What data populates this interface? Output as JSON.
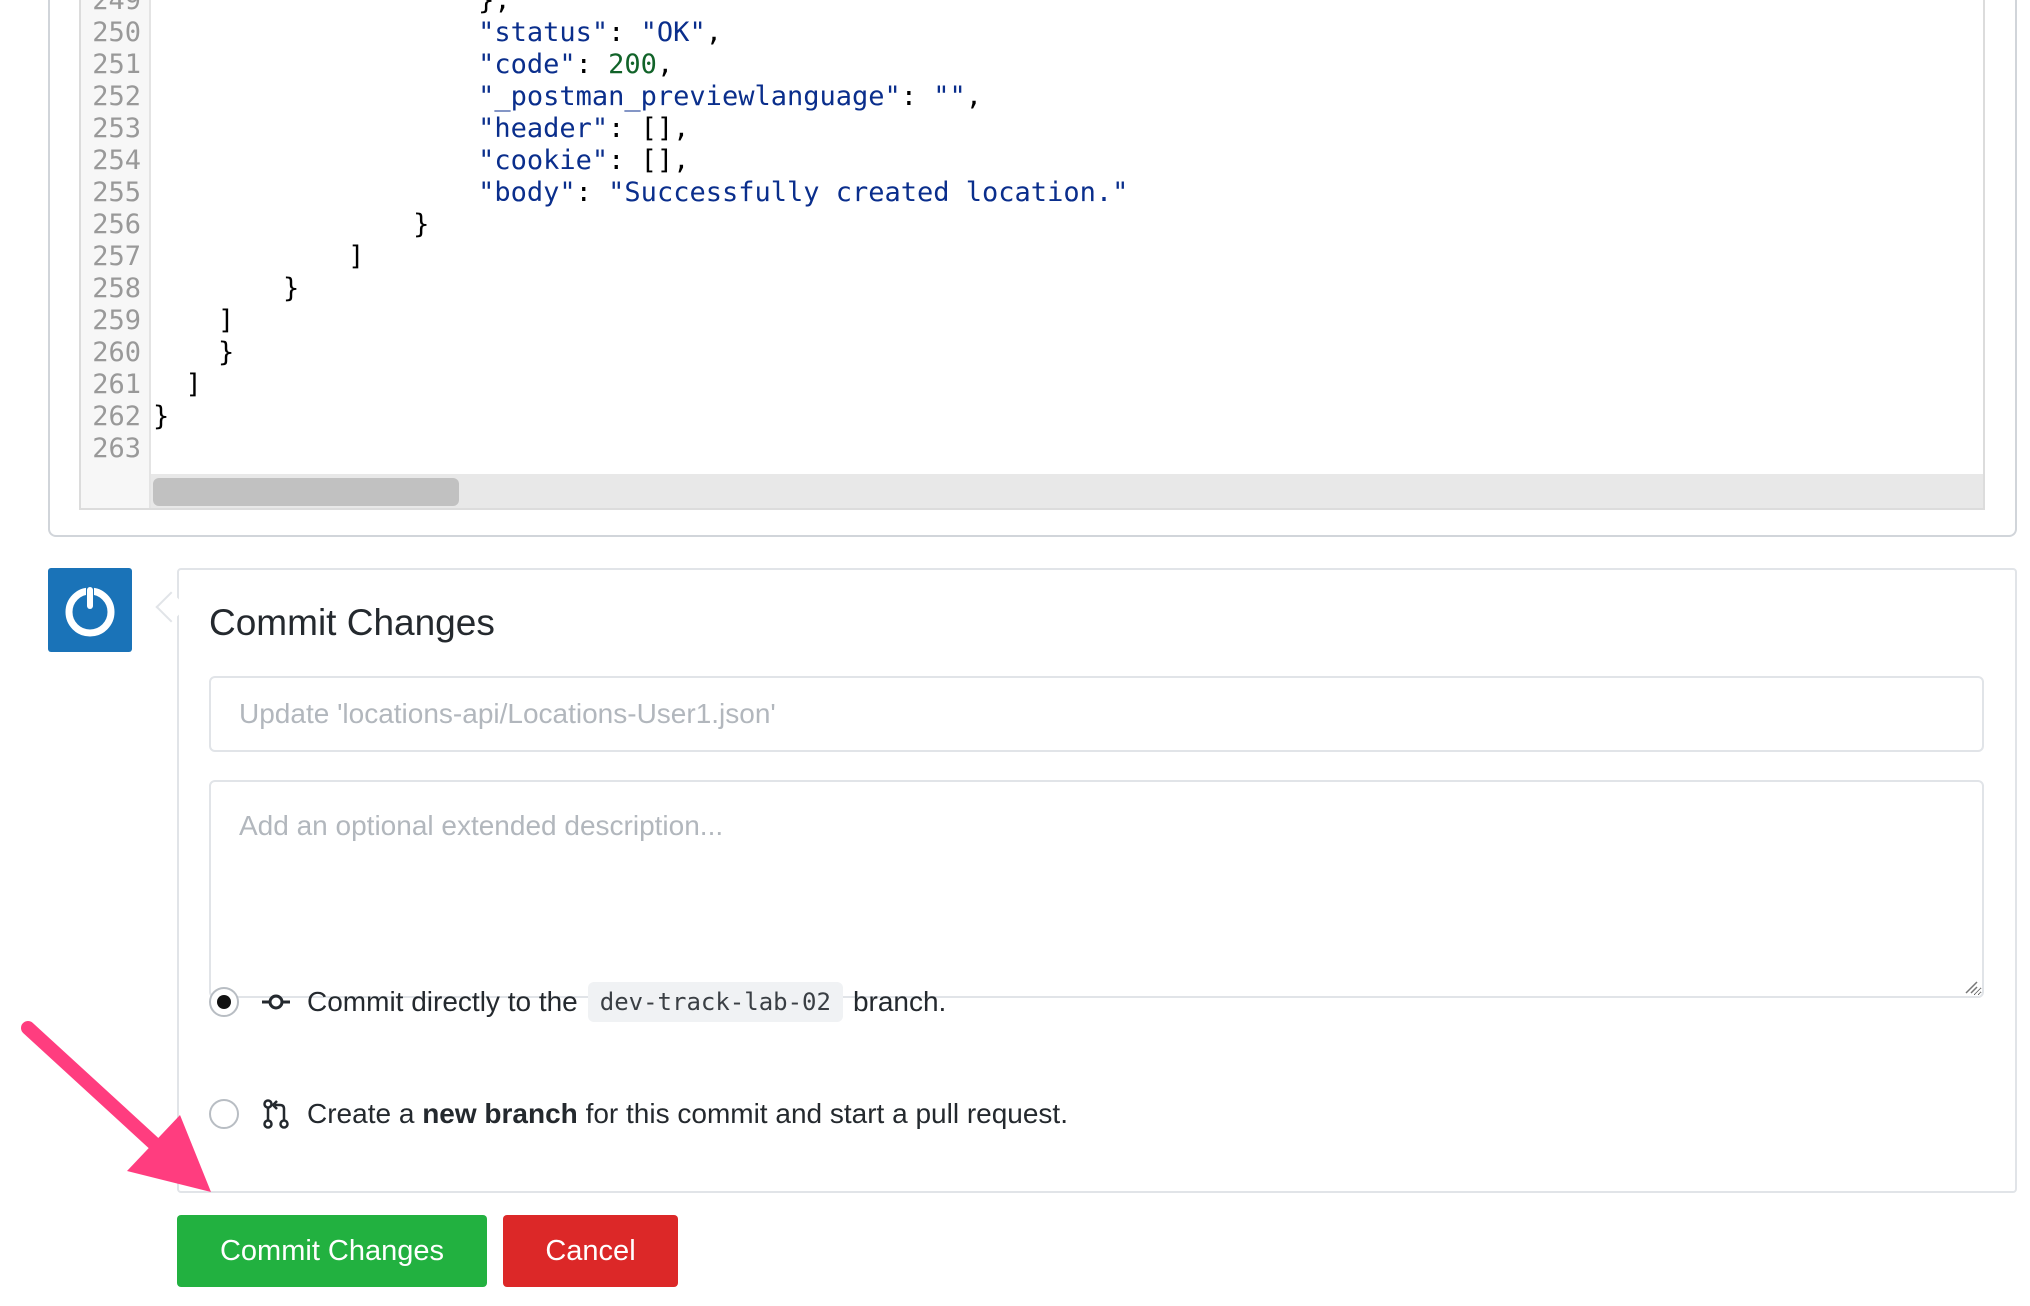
{
  "editor": {
    "lines": [
      {
        "num": "249",
        "code": "                    },"
      },
      {
        "num": "250",
        "code": "                    \"status\": \"OK\","
      },
      {
        "num": "251",
        "code": "                    \"code\": 200,"
      },
      {
        "num": "252",
        "code": "                    \"_postman_previewlanguage\": \"\","
      },
      {
        "num": "253",
        "code": "                    \"header\": [],"
      },
      {
        "num": "254",
        "code": "                    \"cookie\": [],"
      },
      {
        "num": "255",
        "code": "                    \"body\": \"Successfully created location.\""
      },
      {
        "num": "256",
        "code": "                }"
      },
      {
        "num": "257",
        "code": "            ]"
      },
      {
        "num": "258",
        "code": "        }"
      },
      {
        "num": "259",
        "code": "    ]"
      },
      {
        "num": "260",
        "code": "    }"
      },
      {
        "num": "261",
        "code": "  ]"
      },
      {
        "num": "262",
        "code": "}"
      },
      {
        "num": "263",
        "code": ""
      }
    ]
  },
  "avatar": {
    "icon": "power-icon",
    "color": "#1a73b8"
  },
  "commit": {
    "title": "Commit Changes",
    "summary_placeholder": "Update 'locations-api/Locations-User1.json'",
    "description_placeholder": "Add an optional extended description...",
    "option_direct": {
      "prefix": "Commit directly to the",
      "branch": "dev-track-lab-02",
      "suffix": "branch.",
      "selected": true,
      "icon": "git-commit-icon"
    },
    "option_new_branch": {
      "prefix": "Create a",
      "bold": "new branch",
      "suffix": "for this commit and start a pull request.",
      "selected": false,
      "icon": "git-pull-request-icon"
    }
  },
  "buttons": {
    "commit_label": "Commit Changes",
    "cancel_label": "Cancel",
    "commit_color": "#22b140",
    "cancel_color": "#dc2828"
  },
  "annotation": {
    "arrow_color": "#ff3d7f"
  }
}
